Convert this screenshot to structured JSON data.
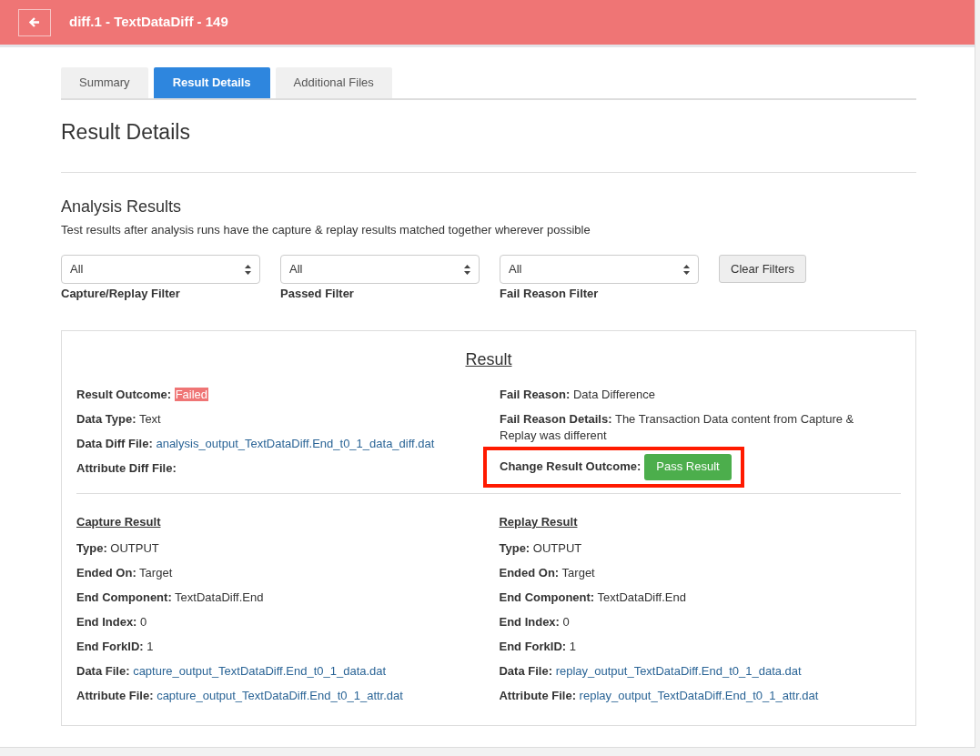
{
  "header": {
    "title": "diff.1 - TextDataDiff - 149"
  },
  "tabs": [
    {
      "label": "Summary",
      "selected": false
    },
    {
      "label": "Result Details",
      "selected": true
    },
    {
      "label": "Additional Files",
      "selected": false
    }
  ],
  "page_title": "Result Details",
  "analysis": {
    "title": "Analysis Results",
    "description": "Test results after analysis runs have the capture & replay results matched together wherever possible",
    "filters": [
      {
        "value": "All",
        "label": "Capture/Replay Filter"
      },
      {
        "value": "All",
        "label": "Passed Filter"
      },
      {
        "value": "All",
        "label": "Fail Reason Filter"
      }
    ],
    "clear_button": "Clear Filters"
  },
  "result": {
    "title": "Result",
    "left": [
      {
        "label": "Result Outcome:",
        "value": "Failed",
        "kind": "badge"
      },
      {
        "label": "Data Type:",
        "value": "Text",
        "kind": "text"
      },
      {
        "label": "Data Diff File:",
        "value": "analysis_output_TextDataDiff.End_t0_1_data_diff.dat",
        "kind": "link"
      },
      {
        "label": "Attribute Diff File:"
      }
    ],
    "right": [
      {
        "label": "Fail Reason:",
        "value": "Data Difference",
        "kind": "text"
      },
      {
        "label": "Fail Reason Details:",
        "value": "The Transaction Data content from Capture & Replay was different",
        "kind": "text"
      }
    ],
    "change": {
      "label": "Change Result Outcome:",
      "button": "Pass Result",
      "highlighted": true
    },
    "sections": [
      {
        "title": "Capture Result",
        "fields": [
          {
            "label": "Type:",
            "value": "OUTPUT",
            "kind": "text"
          },
          {
            "label": "Ended On:",
            "value": "Target",
            "kind": "text"
          },
          {
            "label": "End Component:",
            "value": "TextDataDiff.End",
            "kind": "text"
          },
          {
            "label": "End Index:",
            "value": "0",
            "kind": "text"
          },
          {
            "label": "End ForkID:",
            "value": "1",
            "kind": "text"
          },
          {
            "label": "Data File:",
            "value": "capture_output_TextDataDiff.End_t0_1_data.dat",
            "kind": "link"
          },
          {
            "label": "Attribute File:",
            "value": "capture_output_TextDataDiff.End_t0_1_attr.dat",
            "kind": "link"
          }
        ]
      },
      {
        "title": "Replay Result",
        "fields": [
          {
            "label": "Type:",
            "value": "OUTPUT",
            "kind": "text"
          },
          {
            "label": "Ended On:",
            "value": "Target",
            "kind": "text"
          },
          {
            "label": "End Component:",
            "value": "TextDataDiff.End",
            "kind": "text"
          },
          {
            "label": "End Index:",
            "value": "0",
            "kind": "text"
          },
          {
            "label": "End ForkID:",
            "value": "1",
            "kind": "text"
          },
          {
            "label": "Data File:",
            "value": "replay_output_TextDataDiff.End_t0_1_data.dat",
            "kind": "link"
          },
          {
            "label": "Attribute File:",
            "value": "replay_output_TextDataDiff.End_t0_1_attr.dat",
            "kind": "link"
          }
        ]
      }
    ]
  }
}
